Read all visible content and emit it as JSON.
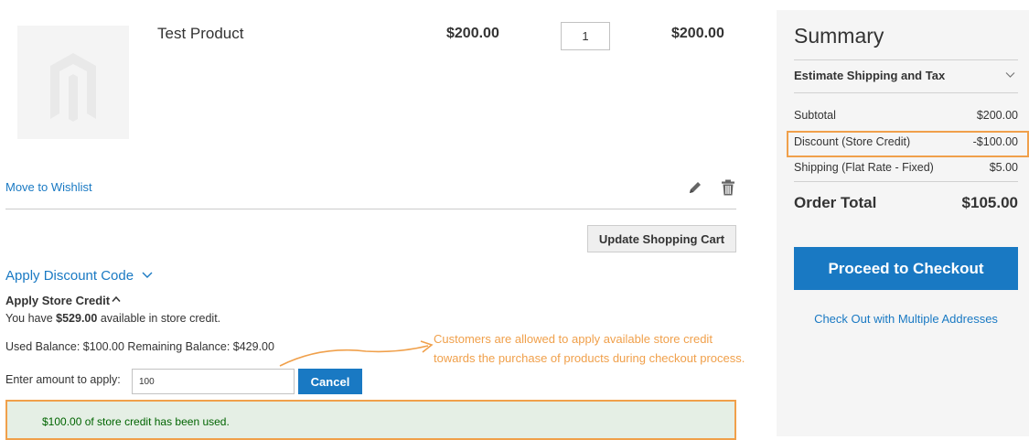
{
  "cart": {
    "item": {
      "name": "Test Product",
      "price": "$200.00",
      "qty": "1",
      "subtotal": "$200.00",
      "image_icon": "magento-logo-placeholder"
    },
    "move_to_wishlist": "Move to Wishlist",
    "edit_icon": "pencil-icon",
    "delete_icon": "trash-icon",
    "update_button": "Update Shopping Cart"
  },
  "discount": {
    "title": "Apply Discount Code",
    "icon": "chevron-down-icon"
  },
  "store_credit": {
    "title": "Apply Store Credit",
    "icon": "chevron-up-icon",
    "available_prefix": "You have ",
    "available_amount": "$529.00",
    "available_suffix": " available in store credit.",
    "balance_text": "Used Balance: $100.00 Remaining Balance: $429.00",
    "enter_label": "Enter amount to apply:",
    "amount_value": "100",
    "cancel_button": "Cancel",
    "success_message": "$100.00 of store credit has been used."
  },
  "annotation": {
    "line1": "Customers are allowed to apply available store credit",
    "line2": "towards the purchase of products during checkout process.",
    "color": "#f0a04b"
  },
  "summary": {
    "title": "Summary",
    "estimate_label": "Estimate Shipping and Tax",
    "estimate_icon": "chevron-down-icon",
    "rows": [
      {
        "label": "Subtotal",
        "value": "$200.00"
      },
      {
        "label": "Discount (Store Credit)",
        "value": "-$100.00"
      },
      {
        "label": "Shipping (Flat Rate - Fixed)",
        "value": "$5.00"
      }
    ],
    "order_total_label": "Order Total",
    "order_total_value": "$105.00",
    "checkout_button": "Proceed to Checkout",
    "multi_address_link": "Check Out with Multiple Addresses"
  },
  "colors": {
    "accent": "#1979c3",
    "highlight": "#f0a04b",
    "success_bg": "#e5efe5",
    "success_text": "#006400"
  }
}
